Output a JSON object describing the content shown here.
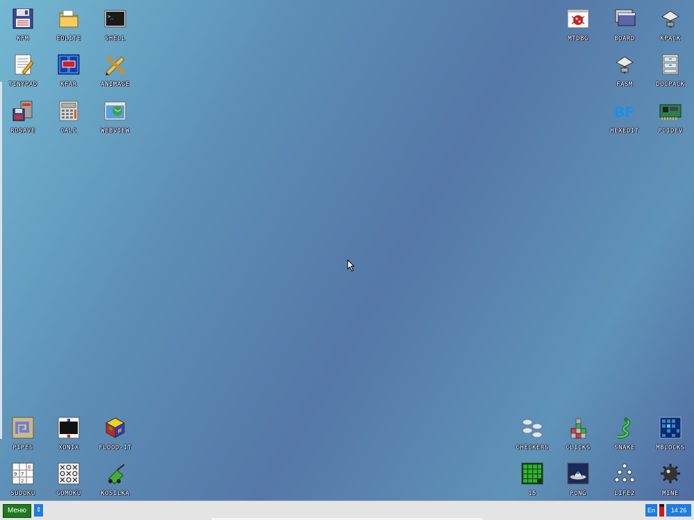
{
  "desktop": {
    "icons": {
      "kfm": "KFM",
      "eolite": "EOLITE",
      "shell": "SHELL",
      "tinypad": "TINYPAD",
      "kfar": "KFAR",
      "animage": "ANIMAGE",
      "rdsave": "RDSAVE",
      "calc": "CALC",
      "webview": "WEBVIEW",
      "mtdbg": "MTDBG",
      "board": "BOARD",
      "kpack": "KPACK",
      "fasm": "FASM",
      "docpack": "DOCPACK",
      "hexedit": "HEXEDIT",
      "pcidev": "PCIDEV",
      "pipes": "PIPES",
      "xonix": "XONIX",
      "floodit": "FLOOD-IT",
      "sudoku": "SUDOKU",
      "gomoku": "GOMOKU",
      "kosilka": "KOSILKA",
      "checkers": "CHECKERS",
      "clicks": "CLICKS",
      "snake": "SNAKE",
      "mblocks": "MBLOCKS",
      "fifteen": "15",
      "pong": "PONG",
      "life2": "LIFE2",
      "mine": "MINE"
    },
    "hexedit_glyph": "BF"
  },
  "taskbar": {
    "menu_label": "Меню",
    "switch_glyph": "⇕",
    "language": "En",
    "clock": "14 26",
    "cpu_load": 0.8
  },
  "colors": {
    "menu_button": "#1e7a1e",
    "tray_accent": "#1f7be0",
    "cpu_bar": "#d01818"
  }
}
